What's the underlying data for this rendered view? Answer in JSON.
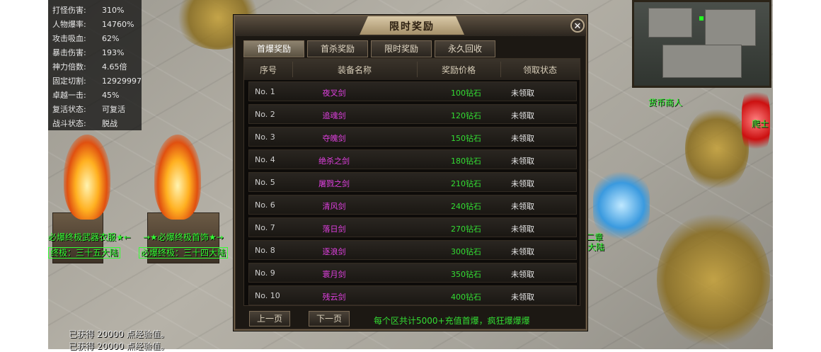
{
  "stats": [
    {
      "label": "打怪伤害:",
      "value": "310%"
    },
    {
      "label": "人物爆率:",
      "value": "14760%"
    },
    {
      "label": "攻击吸血:",
      "value": "62%"
    },
    {
      "label": "暴击伤害:",
      "value": "193%"
    },
    {
      "label": "神力倍数:",
      "value": "4.65倍"
    },
    {
      "label": "固定切割:",
      "value": "12929997"
    },
    {
      "label": "卓越一击:",
      "value": "45%"
    },
    {
      "label": "复活状态:",
      "value": "可复活"
    },
    {
      "label": "战斗状态:",
      "value": "脱战"
    }
  ],
  "scene": {
    "left_banner_1": "必爆终极武器衣服★←",
    "left_banner_2": "→★必爆终极首饰★→",
    "left_box_1": "终极：三十五大陆",
    "left_box_2": "必爆终极：三十四大陆",
    "npc_top": "货币商人",
    "npc_right": "爬士",
    "npc_center_1": "二章",
    "npc_center_2": "大陆",
    "bottom_line_1": "已获得 20000 点经验值。",
    "bottom_line_2": "已获得 20000 点经验值。"
  },
  "dialog": {
    "title": "限时奖励",
    "close_glyph": "✕",
    "tabs": [
      "首爆奖励",
      "首杀奖励",
      "限时奖励",
      "永久回收"
    ],
    "active_tab": 0,
    "columns": [
      "序号",
      "装备名称",
      "奖励价格",
      "领取状态"
    ],
    "rows": [
      {
        "no": "No.  1",
        "name": "夜叉剑",
        "price": "100钻石",
        "status": "未领取"
      },
      {
        "no": "No.  2",
        "name": "追魂剑",
        "price": "120钻石",
        "status": "未领取"
      },
      {
        "no": "No.  3",
        "name": "夺魄剑",
        "price": "150钻石",
        "status": "未领取"
      },
      {
        "no": "No.  4",
        "name": "绝杀之剑",
        "price": "180钻石",
        "status": "未领取"
      },
      {
        "no": "No.  5",
        "name": "屠戮之剑",
        "price": "210钻石",
        "status": "未领取"
      },
      {
        "no": "No.  6",
        "name": "清风剑",
        "price": "240钻石",
        "status": "未领取"
      },
      {
        "no": "No.  7",
        "name": "落日剑",
        "price": "270钻石",
        "status": "未领取"
      },
      {
        "no": "No.  8",
        "name": "逐浪剑",
        "price": "300钻石",
        "status": "未领取"
      },
      {
        "no": "No.  9",
        "name": "寰月剑",
        "price": "350钻石",
        "status": "未领取"
      },
      {
        "no": "No. 10",
        "name": "残云剑",
        "price": "400钻石",
        "status": "未领取"
      }
    ],
    "prev_label": "上一页",
    "next_label": "下一页",
    "footer_note": "每个区共计5000+充值首爆，疯狂爆爆爆"
  },
  "colors": {
    "item_name": "#e040e0",
    "price": "#33dd33",
    "npc_text": "#33ff33"
  }
}
